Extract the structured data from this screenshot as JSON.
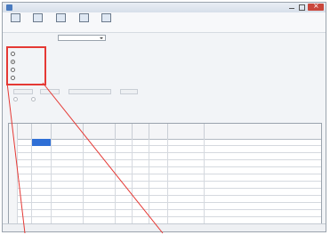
{
  "window": {
    "title": "",
    "controls": {
      "minimize": "minimize-icon",
      "maximize": "maximize-icon",
      "close": "close-icon"
    }
  },
  "toolbar": {
    "buttons": [
      {
        "label": "",
        "icon": "document-icon"
      },
      {
        "label": "",
        "icon": "save-icon"
      },
      {
        "label": "",
        "icon": "copy-icon"
      },
      {
        "label": "",
        "icon": "table-icon"
      },
      {
        "label": "",
        "icon": "export-icon"
      }
    ]
  },
  "options": {
    "prefix_label": "",
    "middle_label": "",
    "dropdown_value": ""
  },
  "radio_group": {
    "items": [
      {
        "label": "",
        "checked": false
      },
      {
        "label": "",
        "checked": true
      },
      {
        "label": "",
        "checked": false
      },
      {
        "label": "",
        "checked": false
      }
    ]
  },
  "disabled_controls": {
    "buttons": [
      "",
      "",
      "",
      ""
    ],
    "radios": [
      "",
      ""
    ]
  },
  "grid": {
    "columns": [
      {
        "line1": "",
        "line2": ""
      },
      {
        "line1": "",
        "line2": ""
      },
      {
        "line1": "",
        "line2": ""
      },
      {
        "line1": "",
        "line2": ""
      },
      {
        "line1": "",
        "line2": ""
      },
      {
        "line1": "",
        "line2": ""
      },
      {
        "line1": "",
        "line2": ""
      },
      {
        "line1": "",
        "line2": ""
      },
      {
        "line1": "",
        "line2": ""
      },
      {
        "line1": "",
        "line2": ""
      }
    ],
    "row_numbers": [
      "",
      "",
      "",
      "",
      "",
      "",
      "",
      "",
      "",
      "",
      "",
      ""
    ],
    "selected_cell": {
      "row": 0,
      "col": 2
    }
  },
  "status": {
    "left": "",
    "right": ""
  },
  "colors": {
    "highlight_border": "#e53935",
    "callout_line": "#e53935",
    "selection": "#2f6fd6"
  }
}
